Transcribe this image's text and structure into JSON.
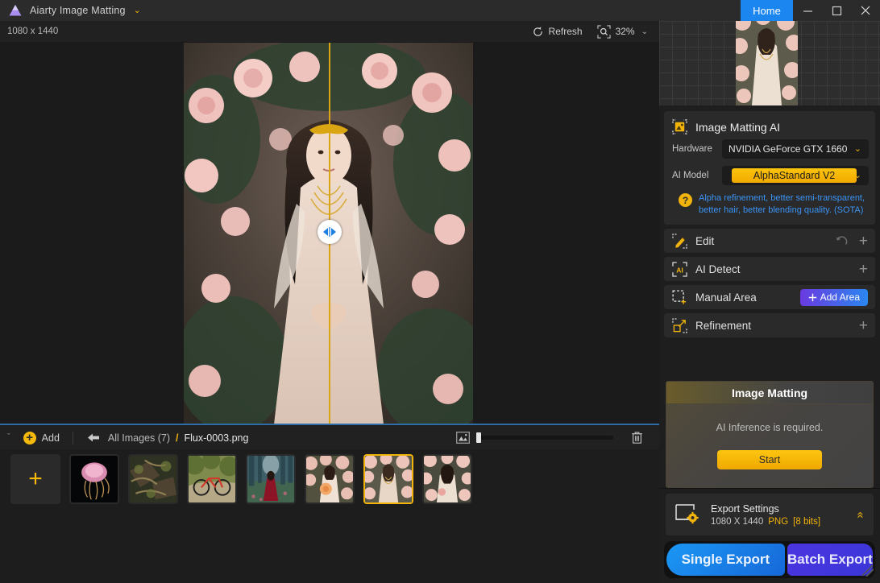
{
  "titlebar": {
    "app_name": "Aiarty Image Matting",
    "caret": "⌄",
    "home_label": "Home"
  },
  "subbar": {
    "dimensions": "1080 x 1440",
    "refresh_label": "Refresh",
    "zoom_level": "32%",
    "zoom_caret": "⌄"
  },
  "strip_bar": {
    "collapse_caret": "ˇ",
    "add_label": "Add",
    "plus": "+",
    "breadcrumb_all": "All Images (7)",
    "breadcrumb_sep": "/",
    "breadcrumb_file": "Flux-0003.png"
  },
  "filmstrip": {
    "add_tile": "+",
    "thumbs": [
      {
        "name": "jellyfish"
      },
      {
        "name": "driftwood"
      },
      {
        "name": "bicycle"
      },
      {
        "name": "red-dress-forest"
      },
      {
        "name": "bride-bouquet"
      },
      {
        "name": "woman-roses-selected"
      },
      {
        "name": "woman-roses-portrait"
      }
    ],
    "selected_index": 5
  },
  "panel": {
    "matting": {
      "title": "Image Matting AI",
      "hardware_label": "Hardware",
      "hardware_value": "NVIDIA GeForce GTX 1660",
      "model_label": "AI Model",
      "model_value": "AlphaStandard  V2",
      "note_line1": "Alpha refinement, better semi-transparent,",
      "note_line2": "better hair, better blending quality. (SOTA)",
      "help_glyph": "?",
      "caret": "⌄"
    },
    "sections": [
      {
        "name": "edit",
        "label": "Edit",
        "has_undo": true,
        "plus": "+"
      },
      {
        "name": "ai-detect",
        "label": "AI Detect",
        "has_undo": false,
        "plus": "+"
      },
      {
        "name": "manual-area",
        "label": "Manual Area",
        "button": "Add Area"
      },
      {
        "name": "refinement",
        "label": "Refinement",
        "has_undo": false,
        "plus": "+"
      }
    ],
    "action": {
      "heading": "Image Matting",
      "message": "AI Inference is required.",
      "start_label": "Start"
    },
    "export": {
      "title": "Export Settings",
      "size": "1080 X 1440",
      "format": "PNG",
      "bits": "[8 bits]",
      "collapse": "«",
      "single_label": "Single Export",
      "batch_label": "Batch Export"
    }
  },
  "colors": {
    "accent_gold": "#f2b40b",
    "accent_blue": "#1b85f0",
    "accent_purple": "#4b35e0",
    "note_blue": "#3a93f5",
    "panel_bg": "#2a2a2a",
    "app_bg": "#1b1b1b"
  }
}
